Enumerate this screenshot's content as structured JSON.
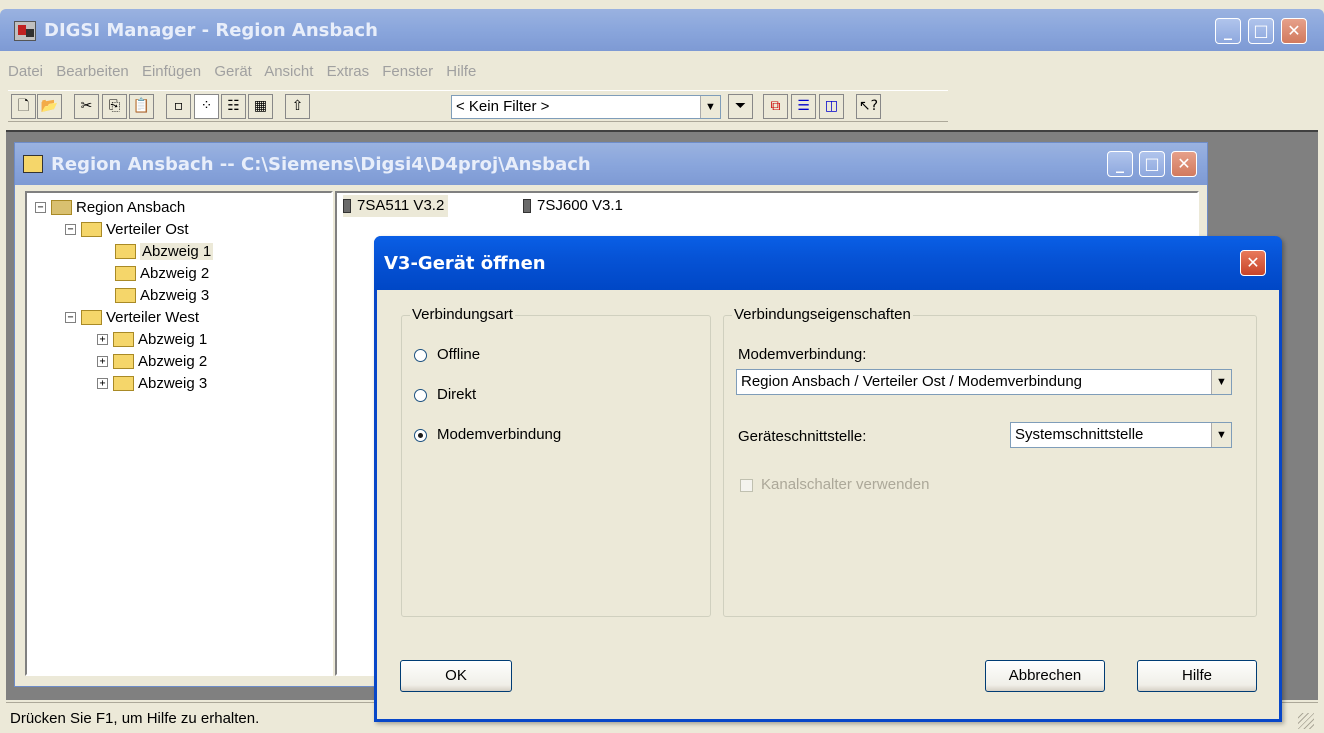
{
  "app": {
    "title": "DIGSI Manager - Region Ansbach",
    "menu": [
      "Datei",
      "Bearbeiten",
      "Einfügen",
      "Gerät",
      "Ansicht",
      "Extras",
      "Fenster",
      "Hilfe"
    ],
    "filter_value": "< Kein Filter >",
    "status_text": "Drücken Sie F1, um Hilfe zu erhalten."
  },
  "project_window": {
    "title": "Region Ansbach -- C:\\Siemens\\Digsi4\\D4proj\\Ansbach",
    "tree": {
      "root": "Region Ansbach",
      "groups": [
        {
          "label": "Verteiler Ost",
          "expanded": true,
          "children": [
            "Abzweig 1",
            "Abzweig 2",
            "Abzweig 3"
          ]
        },
        {
          "label": "Verteiler West",
          "expanded": true,
          "children": [
            "Abzweig 1",
            "Abzweig 2",
            "Abzweig 3"
          ]
        }
      ],
      "selected": "Abzweig 1"
    },
    "devices": [
      "7SA511 V3.2",
      "7SJ600 V3.1"
    ]
  },
  "dialog": {
    "title": "V3-Gerät öffnen",
    "connection_group": "Verbindungsart",
    "options": [
      "Offline",
      "Direkt",
      "Modemverbindung"
    ],
    "selected_option": "Modemverbindung",
    "props_group": "Verbindungseigenschaften",
    "modem_label": "Modemverbindung:",
    "modem_value": "Region Ansbach / Verteiler Ost / Modemverbindung",
    "interface_label": "Geräteschnittstelle:",
    "interface_value": "Systemschnittstelle",
    "channel_switch_label": "Kanalschalter verwenden",
    "ok_label": "OK",
    "cancel_label": "Abbrechen",
    "help_label": "Hilfe"
  },
  "colors": {
    "titlebar_active": "#0653d6",
    "dialog_face": "#ece9d8",
    "mdi_background": "#808080",
    "close_button": "#c8452a"
  }
}
